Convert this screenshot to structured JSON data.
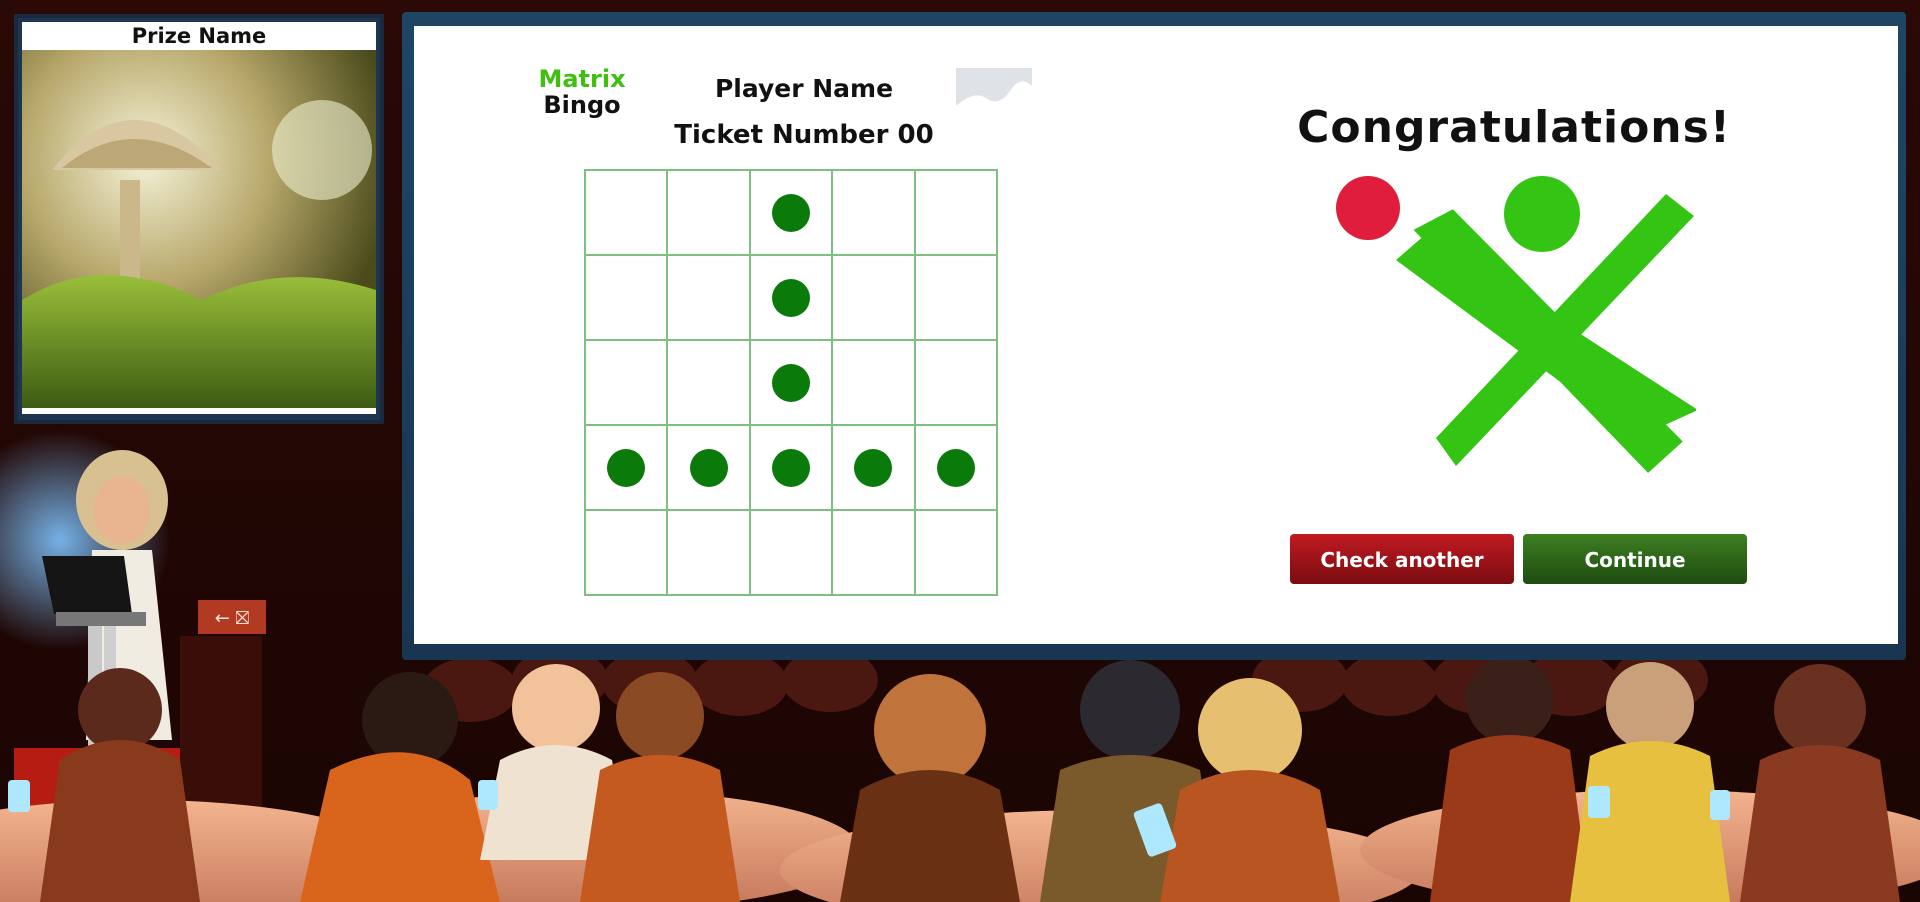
{
  "prize": {
    "title": "Prize Name"
  },
  "ticket": {
    "logo_line1": "Matrix",
    "logo_line2": "Bingo",
    "player_name": "Player Name",
    "ticket_number": "Ticket Number 00",
    "grid": [
      [
        0,
        0,
        1,
        0,
        0
      ],
      [
        0,
        0,
        1,
        0,
        0
      ],
      [
        0,
        0,
        1,
        0,
        0
      ],
      [
        1,
        1,
        1,
        1,
        1
      ],
      [
        0,
        0,
        0,
        0,
        0
      ]
    ]
  },
  "result": {
    "heading": "Congratulations!",
    "check_another_label": "Check another",
    "continue_label": "Continue"
  },
  "colors": {
    "mark": "#0a7a0a",
    "logo_green": "#3fbf12",
    "logo_red": "#e01e3c",
    "check_button": "#a3151b",
    "continue_button": "#2f6a1a"
  },
  "icons": {
    "avatar": "image-placeholder-icon",
    "exit_sign": "emergency-exit-icon"
  }
}
